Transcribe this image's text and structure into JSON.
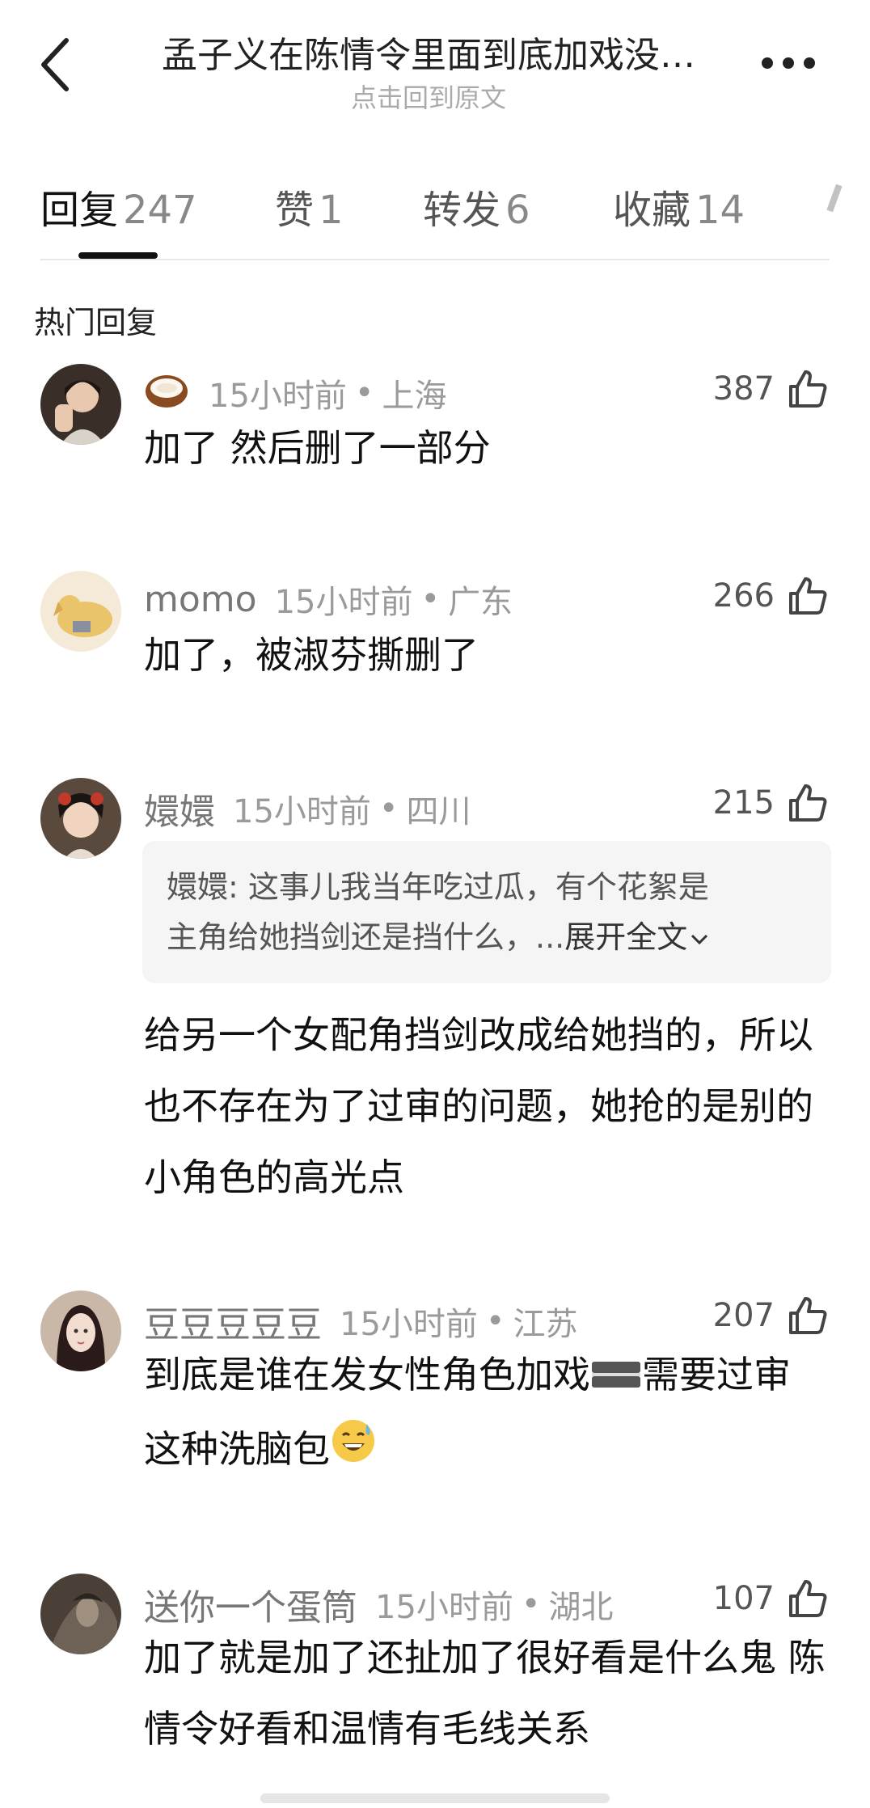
{
  "header": {
    "back_icon": "chevron-left-icon",
    "title": "孟子义在陈情令里面到底加戏没…",
    "subtitle": "点击回到原文",
    "more_icon": "more-dots-icon"
  },
  "tabs": [
    {
      "label": "回复",
      "count": "247",
      "active": true
    },
    {
      "label": "赞",
      "count": "1",
      "active": false
    },
    {
      "label": "转发",
      "count": "6",
      "active": false
    },
    {
      "label": "收藏",
      "count": "14",
      "active": false
    }
  ],
  "section_title": "热门回复",
  "comments": [
    {
      "username": "",
      "badge": "coconut-emoji",
      "time": "15小时前",
      "separator": "•",
      "location": "上海",
      "likes": "387",
      "text": "加了 然后删了一部分"
    },
    {
      "username": "momo",
      "time": "15小时前",
      "separator": "•",
      "location": "广东",
      "likes": "266",
      "text": "加了，被淑芬撕删了"
    },
    {
      "username": "嬛嬛",
      "time": "15小时前",
      "separator": "•",
      "location": "四川",
      "likes": "215",
      "quote_line1": "嬛嬛: 这事儿我当年吃过瓜，有个花絮是",
      "quote_line2": "主角给她挡剑还是挡什么，...",
      "quote_expand": "展开全文",
      "text": "给另一个女配角挡剑改成给她挡的，所以也不存在为了过审的问题，她抢的是别的小角色的高光点"
    },
    {
      "username": "豆豆豆豆豆",
      "time": "15小时前",
      "separator": "•",
      "location": "江苏",
      "likes": "207",
      "text_part1": "到底是谁在发女性角色加戏",
      "text_part2": "需要过审这种洗脑包"
    },
    {
      "username": "送你一个蛋筒",
      "time": "15小时前",
      "separator": "•",
      "location": "湖北",
      "likes": "107",
      "text": "加了就是加了还扯加了很好看是什么鬼 陈情令好看和温情有毛线关系"
    }
  ],
  "colors": {
    "text": "#111111",
    "meta": "#9a9a9a",
    "quote_bg": "#f5f5f5",
    "accent": "#111111"
  }
}
